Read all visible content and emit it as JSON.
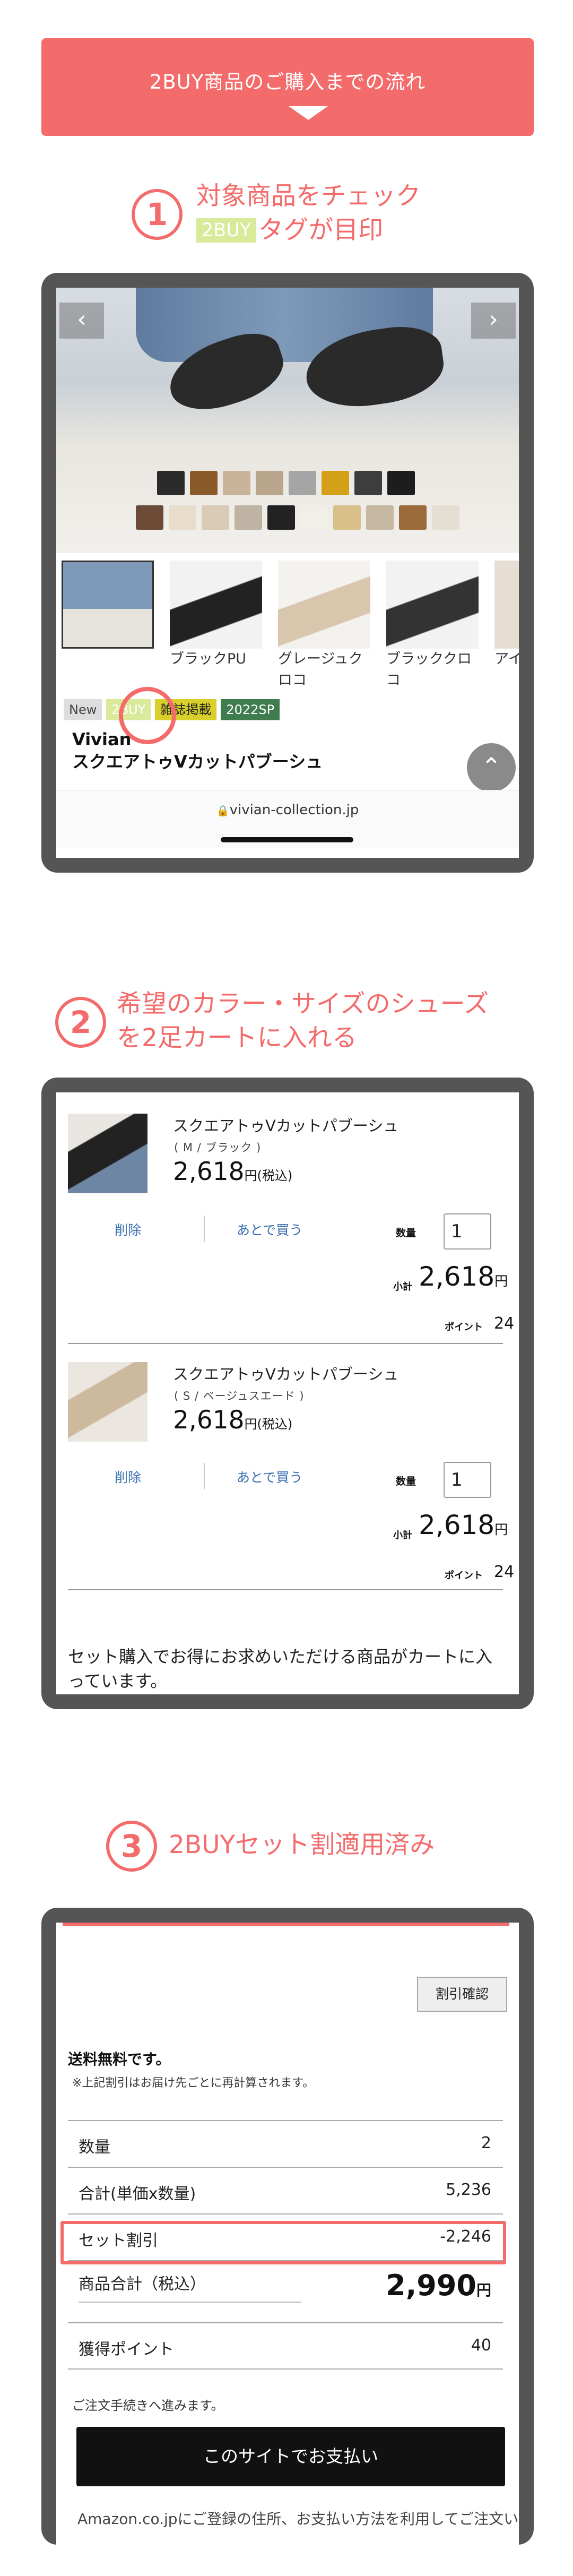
{
  "banner": {
    "title": "2BUY商品のご購入までの流れ"
  },
  "step1": {
    "number": "1",
    "line1": "対象商品をチェック",
    "tag": "2BUY",
    "line2": "タグが目印"
  },
  "product": {
    "thumbs": [
      {
        "label": ""
      },
      {
        "label": "ブラックPU"
      },
      {
        "label": "グレージュクロコ"
      },
      {
        "label": "ブラッククロコ"
      },
      {
        "label": "アイボ"
      }
    ],
    "badges": [
      "New",
      "2BUY",
      "雑誌掲載",
      "2022SP"
    ],
    "brand": "Vivian",
    "name": "スクエアトゥVカットパブーシュ",
    "url": "vivian-collection.jp"
  },
  "step2": {
    "number": "2",
    "line1": "希望のカラー・サイズのシューズ",
    "line2": "を2足カートに入れる"
  },
  "cart": {
    "items": [
      {
        "name": "スクエアトゥVカットパブーシュ",
        "variant": "( M / ブラック )",
        "price": "2,618",
        "price_suffix": "円(税込)",
        "delete": "削除",
        "later": "あとで買う",
        "qty_label": "数量",
        "qty": "1",
        "subtotal_label": "小計",
        "subtotal": "2,618",
        "yen": "円",
        "points_label": "ポイント",
        "points": "24"
      },
      {
        "name": "スクエアトゥVカットパブーシュ",
        "variant": "( S / ベージュスエード )",
        "price": "2,618",
        "price_suffix": "円(税込)",
        "delete": "削除",
        "later": "あとで買う",
        "qty_label": "数量",
        "qty": "1",
        "subtotal_label": "小計",
        "subtotal": "2,618",
        "yen": "円",
        "points_label": "ポイント",
        "points": "24"
      }
    ],
    "note": "セット購入でお得にお求めいただける商品がカートに入っています。"
  },
  "step3": {
    "number": "3",
    "line1": "2BUYセット割適用済み"
  },
  "summary": {
    "discount_check": "割引確認",
    "free_shipping": "送料無料です。",
    "shipping_note": "※上記割引はお届け先ごとに再計算されます。",
    "rows": [
      {
        "label": "数量",
        "value": "2"
      },
      {
        "label": "合計(単価x数量)",
        "value": "5,236"
      },
      {
        "label": "セット割引",
        "value": "-2,246"
      }
    ],
    "total_label": "商品合計（税込）",
    "total": "2,990",
    "total_yen": "円",
    "points_label": "獲得ポイント",
    "points": "40",
    "proceed": "ご注文手続きへ進みます。",
    "pay_button": "このサイトでお支払い",
    "footer_cut": "Amazon.co.jpにご登録の住所、お支払い方法を利用してご注文い"
  },
  "colors": {
    "accent": "#f36b6b",
    "frame": "#555555",
    "link": "#3a6fb0",
    "tag_2buy": "#d9ea9b"
  }
}
